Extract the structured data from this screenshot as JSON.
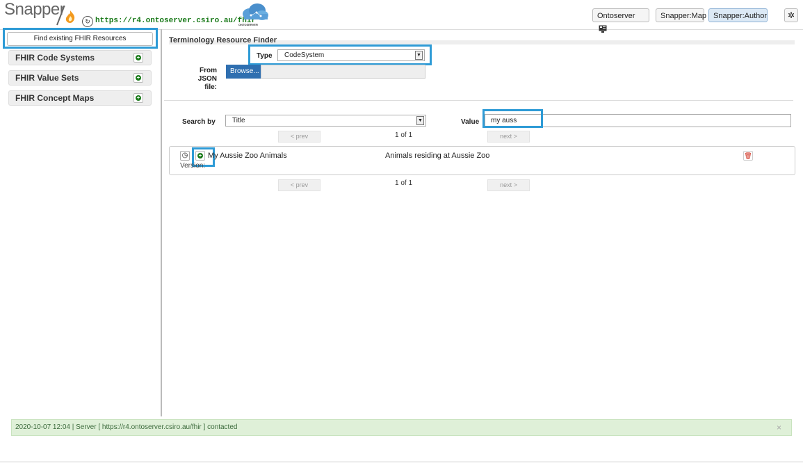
{
  "header": {
    "app_name": "Snapper",
    "server_url": "https://r4.ontoserver.csiro.au/fhir",
    "ontoserver_logo_text": "ONTOSERVER",
    "buttons": {
      "ontoserver": "Ontoserver",
      "map": "Snapper:Map",
      "author": "Snapper:Author"
    },
    "active_button": "Snapper:Author"
  },
  "sidebar": {
    "find_button": "Find existing FHIR Resources",
    "items": [
      {
        "label": "FHIR Code Systems"
      },
      {
        "label": "FHIR Value Sets"
      },
      {
        "label": "FHIR Concept Maps"
      }
    ]
  },
  "finder": {
    "title": "Terminology Resource Finder",
    "type_label": "Type",
    "type_value": "CodeSystem",
    "json_label_line1": "From JSON",
    "json_label_line2": "file:",
    "browse_label": "Browse...",
    "search_by_label": "Search by",
    "search_by_value": "Title",
    "value_label": "Value",
    "value_input": "my auss",
    "prev_label": "< prev",
    "next_label": "next >",
    "page_info": "1 of 1"
  },
  "results": [
    {
      "name": "My Aussie Zoo Animals",
      "description": "Animals residing at Aussie Zoo",
      "version_label": "Version:"
    }
  ],
  "status": {
    "message": "2020-10-07 12:04 | Server [ https://r4.ontoserver.csiro.au/fhir ] contacted",
    "close": "×"
  },
  "colors": {
    "highlight": "#2e9bd6",
    "green_icon": "#1a7a1a",
    "browse_button": "#2f6fb0",
    "status_bg": "#dff0d8"
  },
  "icons": [
    "flame-icon",
    "refresh-icon",
    "ontoserver-cloud-icon",
    "monitor-icon",
    "gear-icon",
    "plus-circle-icon",
    "history-icon",
    "trash-icon",
    "chevron-down-icon",
    "close-icon"
  ]
}
